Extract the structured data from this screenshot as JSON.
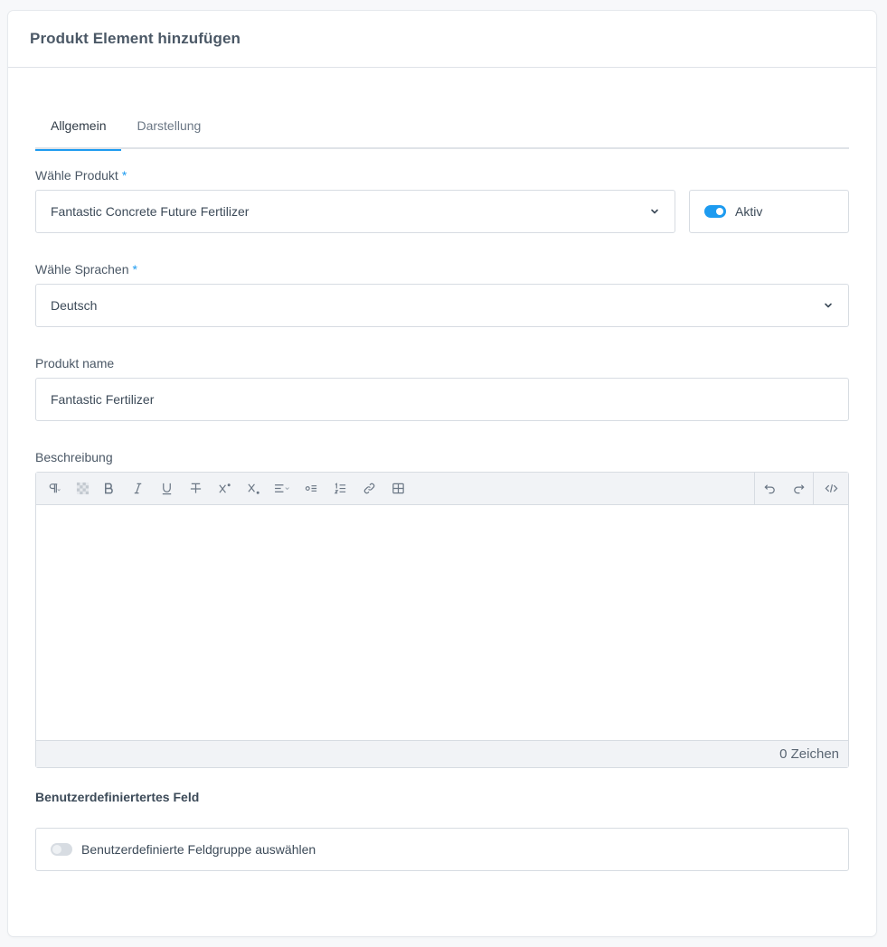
{
  "header": {
    "title": "Produkt Element hinzufügen"
  },
  "tabs": [
    {
      "label": "Allgemein",
      "active": true
    },
    {
      "label": "Darstellung",
      "active": false
    }
  ],
  "product": {
    "label": "Wähle Produkt",
    "required_mark": "*",
    "value": "Fantastic Concrete Future Fertilizer",
    "active_toggle": {
      "label": "Aktiv",
      "on": true
    }
  },
  "languages": {
    "label": "Wähle Sprachen",
    "required_mark": "*",
    "value": "Deutsch"
  },
  "product_name": {
    "label": "Produkt name",
    "value": "Fantastic Fertilizer"
  },
  "description": {
    "label": "Beschreibung",
    "toolbar": {
      "paragraph_icon": "¶",
      "bold": "B",
      "italic": "I",
      "underline": "U",
      "strike": "T",
      "superscript": "X",
      "subscript": "X"
    },
    "char_count": "0 Zeichen"
  },
  "custom_field": {
    "title": "Benutzerdefiniertertes Feld",
    "toggle_label": "Benutzerdefinierte Feldgruppe auswählen",
    "on": false
  },
  "colors": {
    "accent": "#1d9bf0",
    "border": "#d7dce2",
    "toolbar_bg": "#f1f3f6"
  }
}
